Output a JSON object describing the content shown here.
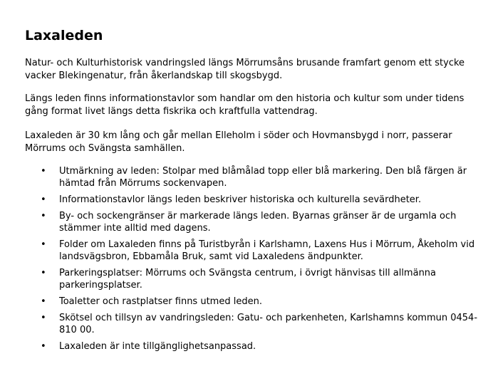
{
  "document": {
    "title": "Laxaleden",
    "paragraphs": [
      "Natur- och Kulturhistorisk vandringsled längs Mörrumsåns brusande framfart genom ett stycke vacker Blekingenatur, från åkerlandskap till skogsbygd.",
      "Längs leden finns informationstavlor som handlar om den historia och kultur som under tidens gång format livet längs detta fiskrika och kraftfulla vattendrag.",
      "Laxaleden är 30 km lång och går mellan Elleholm i söder och Hovmansbygd i norr, passerar Mörrums och Svängsta samhällen."
    ],
    "list_items": [
      "Utmärkning av leden: Stolpar med blåmålad topp eller blå markering. Den blå färgen är hämtad från Mörrums sockenvapen.",
      "Informationstavlor längs leden beskriver historiska och kulturella sevärdheter.",
      "By- och sockengränser är markerade längs leden. Byarnas gränser är de urgamla och stämmer inte alltid med dagens.",
      "Folder om Laxaleden finns på Turistbyrån i Karlshamn, Laxens Hus i Mörrum, Åkeholm vid landsvägsbron, Ebbamåla Bruk, samt vid Laxaledens ändpunkter.",
      "Parkeringsplatser: Mörrums och Svängsta centrum, i övrigt hänvisas till allmänna parkeringsplatser.",
      "Toaletter och rastplatser finns utmed leden.",
      "Skötsel och tillsyn av vandringsleden: Gatu- och parkenheten, Karlshamns kommun 0454-810 00.",
      "Laxaleden är inte tillgänglighetsanpassad."
    ],
    "bullet_glyph": "•"
  }
}
